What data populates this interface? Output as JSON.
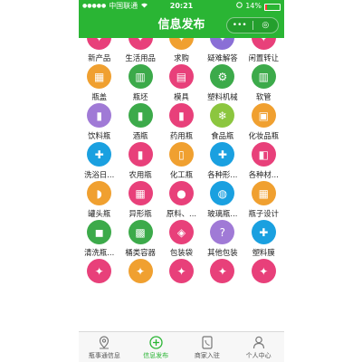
{
  "status_bar": {
    "carrier": "中国联通",
    "time": "20:21",
    "battery": "14%",
    "battery_level": 0.14
  },
  "nav": {
    "title": "信息发布",
    "more_label": "•••",
    "close_label": "◎"
  },
  "colors": {
    "brand_green": "#2ab534",
    "tab_active": "#2ab534"
  },
  "grid": [
    {
      "label": "新产品",
      "color": "#e8407a",
      "icon": "new-product-icon",
      "glyph": "✦"
    },
    {
      "label": "生活用品",
      "color": "#e8407a",
      "icon": "daily-goods-icon",
      "glyph": "✦"
    },
    {
      "label": "求购",
      "color": "#f0a030",
      "icon": "purchase-icon",
      "glyph": "✦"
    },
    {
      "label": "疑难解答",
      "color": "#8a6fd6",
      "icon": "faq-icon",
      "glyph": "✦"
    },
    {
      "label": "闲置转让",
      "color": "#e8407a",
      "icon": "idle-transfer-icon",
      "glyph": "✦"
    },
    {
      "label": "瓶盖",
      "color": "#f0a030",
      "icon": "bottle-cap-icon",
      "glyph": "▦"
    },
    {
      "label": "瓶坯",
      "color": "#3caa4a",
      "icon": "preform-icon",
      "glyph": "▥"
    },
    {
      "label": "模具",
      "color": "#e8407a",
      "icon": "mold-icon",
      "glyph": "▤"
    },
    {
      "label": "塑料机械",
      "color": "#3caa4a",
      "icon": "plastic-machine-icon",
      "glyph": "⚙"
    },
    {
      "label": "软管",
      "color": "#3caa4a",
      "icon": "hose-icon",
      "glyph": "▥"
    },
    {
      "label": "饮料瓶",
      "color": "#a07ad6",
      "icon": "beverage-bottle-icon",
      "glyph": "▮"
    },
    {
      "label": "酒瓶",
      "color": "#3caa4a",
      "icon": "wine-bottle-icon",
      "glyph": "▮"
    },
    {
      "label": "药用瓶",
      "color": "#e8407a",
      "icon": "medicine-bottle-icon",
      "glyph": "▮"
    },
    {
      "label": "食品瓶",
      "color": "#8cc63f",
      "icon": "food-bottle-icon",
      "glyph": "❄"
    },
    {
      "label": "化妆品瓶",
      "color": "#f0a030",
      "icon": "cosmetic-bottle-icon",
      "glyph": "▣"
    },
    {
      "label": "洗浴日...",
      "color": "#1aa0e0",
      "icon": "bath-icon",
      "glyph": "✚"
    },
    {
      "label": "农用瓶",
      "color": "#e8407a",
      "icon": "agri-bottle-icon",
      "glyph": "▮"
    },
    {
      "label": "化工瓶",
      "color": "#f0a030",
      "icon": "chemical-bottle-icon",
      "glyph": "▯"
    },
    {
      "label": "各种形...",
      "color": "#1aa0e0",
      "icon": "various-shapes-icon",
      "glyph": "✚"
    },
    {
      "label": "各种材...",
      "color": "#e8407a",
      "icon": "various-materials-icon",
      "glyph": "◧"
    },
    {
      "label": "罐头瓶",
      "color": "#f0a030",
      "icon": "can-jar-icon",
      "glyph": "◗"
    },
    {
      "label": "异形瓶",
      "color": "#e8407a",
      "icon": "special-bottle-icon",
      "glyph": "▦"
    },
    {
      "label": "原料、...",
      "color": "#e8407a",
      "icon": "raw-material-icon",
      "glyph": "●"
    },
    {
      "label": "玻璃瓶...",
      "color": "#1aa0e0",
      "icon": "glass-bottle-icon",
      "glyph": "◍"
    },
    {
      "label": "瓶子设计",
      "color": "#f0a030",
      "icon": "bottle-design-icon",
      "glyph": "▦"
    },
    {
      "label": "清洗瓶...",
      "color": "#3caa4a",
      "icon": "cleaning-bottle-icon",
      "glyph": "◼"
    },
    {
      "label": "桶类容器",
      "color": "#3caa4a",
      "icon": "barrel-icon",
      "glyph": "▩"
    },
    {
      "label": "包装袋",
      "color": "#e8407a",
      "icon": "packaging-bag-icon",
      "glyph": "◈"
    },
    {
      "label": "其他包装",
      "color": "#a07ad6",
      "icon": "other-packaging-icon",
      "glyph": "?"
    },
    {
      "label": "塑料膜",
      "color": "#1aa0e0",
      "icon": "plastic-film-icon",
      "glyph": "✚"
    },
    {
      "label": "",
      "color": "#e8407a",
      "icon": "partial-icon",
      "glyph": "✦"
    },
    {
      "label": "",
      "color": "#f0a030",
      "icon": "partial-icon",
      "glyph": "✦"
    },
    {
      "label": "",
      "color": "#e8407a",
      "icon": "partial-icon",
      "glyph": "✦"
    },
    {
      "label": "",
      "color": "#e8407a",
      "icon": "partial-icon",
      "glyph": "✦"
    },
    {
      "label": "",
      "color": "#e8407a",
      "icon": "partial-icon",
      "glyph": "✦"
    }
  ],
  "tabs": [
    {
      "label": "瓶事通信息",
      "icon": "location-pin-icon",
      "active": false
    },
    {
      "label": "信息发布",
      "icon": "add-circle-icon",
      "active": true
    },
    {
      "label": "商家入驻",
      "icon": "phone-icon",
      "active": false
    },
    {
      "label": "个人中心",
      "icon": "user-icon",
      "active": false
    }
  ]
}
